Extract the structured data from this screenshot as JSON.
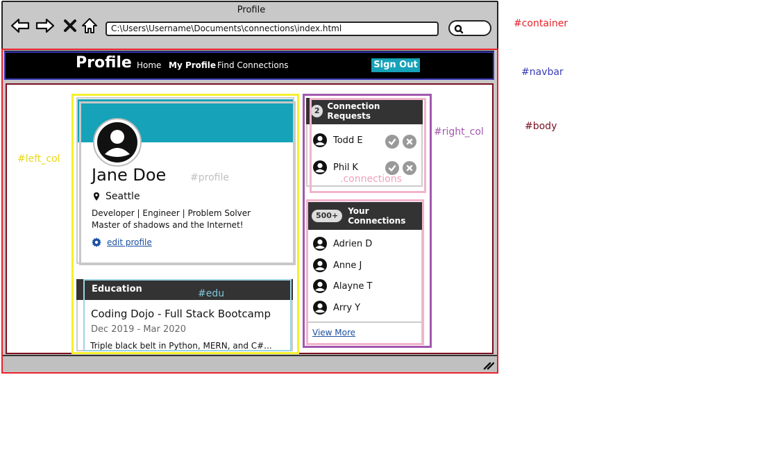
{
  "window": {
    "title": "Profile"
  },
  "browser": {
    "url": "C:\\Users\\Username\\Documents\\connections\\index.html"
  },
  "navbar": {
    "brand": "Profile",
    "links": [
      "Home",
      "My Profile",
      "Find Connections"
    ],
    "sign_out": "Sign Out"
  },
  "profile": {
    "name": "Jane Doe",
    "location": "Seattle",
    "bio_line1": "Developer | Engineer | Problem Solver",
    "bio_line2": "Master of shadows and the Internet!",
    "edit_label": "edit profile"
  },
  "education": {
    "header": "Education",
    "school": "Coding Dojo - Full Stack Bootcamp",
    "dates": "Dec 2019 - Mar 2020",
    "description": "Triple black belt in Python, MERN, and C#..."
  },
  "requests": {
    "count": "2",
    "title": "Connection Requests",
    "people": [
      "Todd E",
      "Phil K"
    ]
  },
  "connections": {
    "count": "500+",
    "title": "Your Connections",
    "people": [
      "Adrien D",
      "Anne J",
      "Alayne T",
      "Arry Y"
    ],
    "view_more": "View More"
  },
  "annotations": {
    "container": "#container",
    "navbar": "#navbar",
    "body": "#body",
    "left_col": "#left_col",
    "right_col": "#right_col",
    "profile": "#profile",
    "connections": ".connections",
    "edu": "#edu"
  },
  "colors": {
    "accent": "#16a2b8",
    "navbar_bg": "#000000",
    "container_outline": "#e8202a",
    "navbar_outline": "#3a3ab8",
    "body_outline": "#7a0f1e",
    "left_col_outline": "#f5f030",
    "right_col_outline": "#a257ae",
    "profile_outline": "#c8c8c8",
    "connections_outline": "#f2b3cc",
    "edu_outline": "#9dd3e4"
  }
}
